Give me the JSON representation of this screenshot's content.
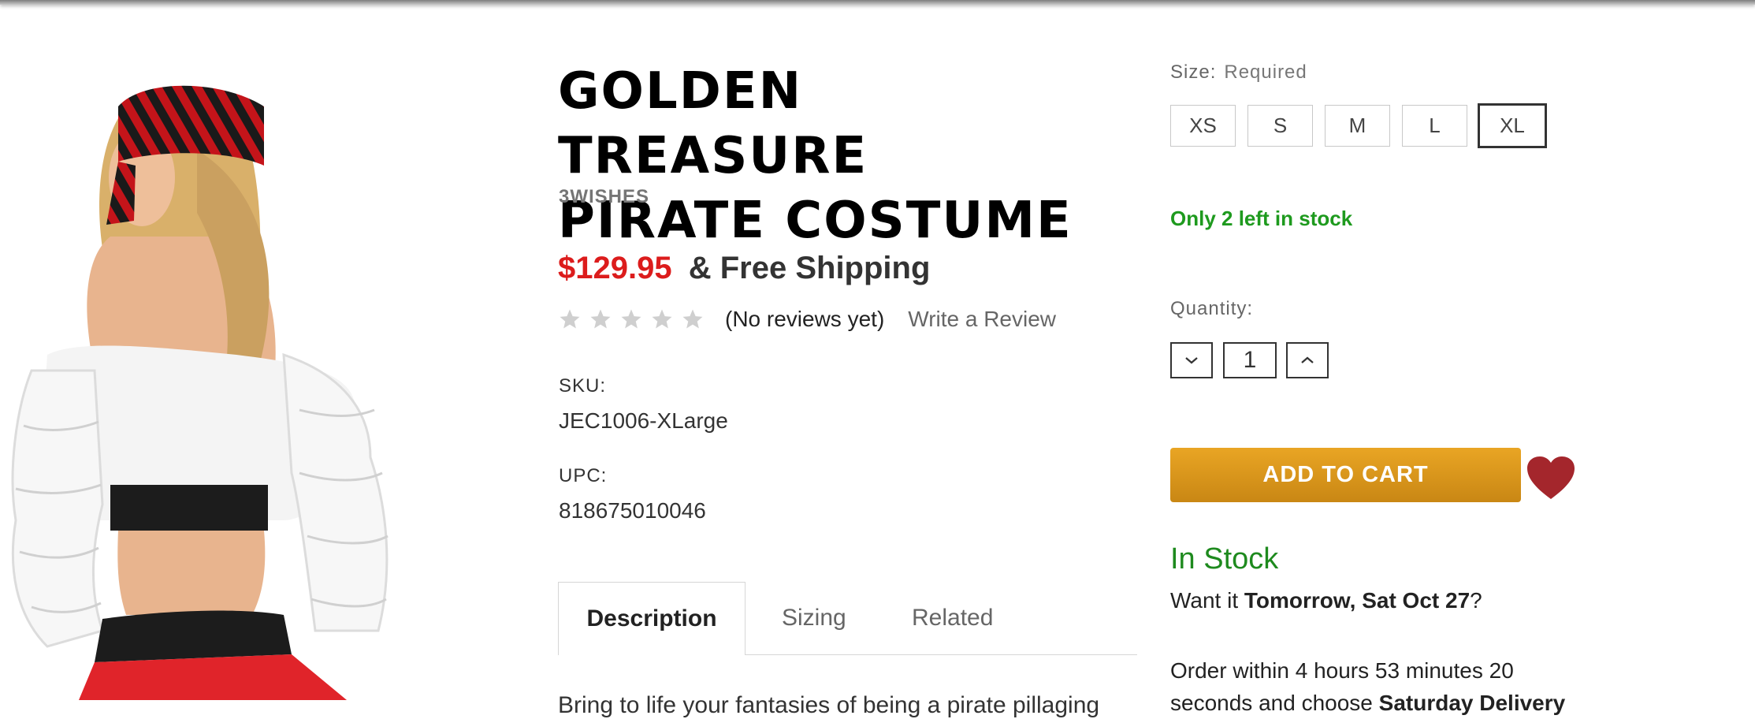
{
  "product": {
    "title_line1": "GOLDEN TREASURE",
    "title_line2": "PIRATE COSTUME",
    "brand": "3WISHES",
    "price": "$129.95",
    "shipping": "& Free Shipping",
    "rating": {
      "stars_filled": 0,
      "stars_total": 5
    },
    "no_reviews": "(No reviews yet)",
    "write_review": "Write a Review",
    "sku_label": "SKU:",
    "sku": "JEC1006-XLarge",
    "upc_label": "UPC:",
    "upc": "818675010046"
  },
  "tabs": {
    "description": "Description",
    "sizing": "Sizing",
    "related": "Related"
  },
  "description_text": "Bring to life your fantasies of being a pirate pillaging",
  "size": {
    "label": "Size:",
    "required": "Required",
    "options": [
      "XS",
      "S",
      "M",
      "L",
      "XL"
    ],
    "selected": "XL"
  },
  "stock_note": "Only 2 left in stock",
  "quantity": {
    "label": "Quantity:",
    "value": "1"
  },
  "cart": {
    "add_label": "ADD TO CART"
  },
  "delivery": {
    "in_stock": "In Stock",
    "want_it_prefix": "Want it ",
    "want_it_date": "Tomorrow, Sat Oct 27",
    "want_it_suffix": "?",
    "order_within_text": "Order within 4 hours 53 minutes 20 seconds and choose ",
    "order_within_bold": "Saturday Delivery"
  },
  "colors": {
    "price": "#dc1c1c",
    "stock_green": "#1e9a1e",
    "cart_button": "#e0a020",
    "wishlist_heart": "#a4262c"
  },
  "icons": {
    "star": "star-icon",
    "qty_decrease": "chevron-down-icon",
    "qty_increase": "chevron-up-icon",
    "wishlist": "heart-icon"
  }
}
